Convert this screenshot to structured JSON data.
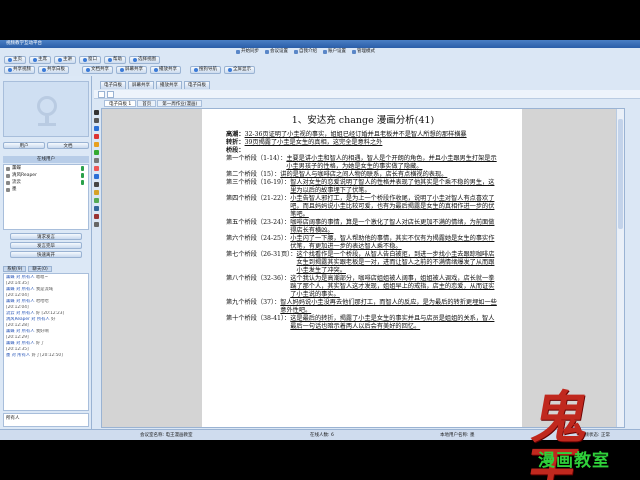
{
  "app": {
    "title": "视频教学互动平台",
    "menu": [
      "开始同步",
      "会议设置",
      "自我介绍",
      "账户设置",
      "管理模式"
    ]
  },
  "left_toolbar": {
    "row1": [
      "主页",
      "主席",
      "主讲",
      "窗口",
      "帮助",
      "选择视图"
    ],
    "row2": [
      "共享视频",
      "共享白板"
    ]
  },
  "right_toolbar": {
    "row1": [
      "文档共享",
      "屏幕共享",
      "播放共享",
      "搜狗导航",
      "全屏显示"
    ],
    "doc_tabs": [
      "电子白板",
      "屏幕共享",
      "播放共享",
      "电子白板"
    ],
    "sub_tabs": [
      "电子白板 1",
      "首页",
      "第一周作业(漫画)"
    ]
  },
  "left_panel": {
    "tabs": [
      "用户",
      "文档"
    ],
    "userlist_header": "在线用户",
    "users": [
      "薰蝶",
      "清风Reaper",
      "流云",
      "墨"
    ],
    "request_button": "请求发言",
    "release_button": "发言完毕",
    "fast_button": "快速离开",
    "chat_tabs": [
      "系统(9)",
      "聊天(0)"
    ],
    "chat_lines": [
      {
        "name": "薰蝶 对 所有人",
        "text": "嗯嗯~"
      },
      {
        "name": "",
        "text": "[20:14:35]"
      },
      {
        "name": "薰蝶 对 所有人",
        "text": "我是流域"
      },
      {
        "name": "",
        "text": "[20:12:04]"
      },
      {
        "name": "薰蝶 对 所有人",
        "text": "哈哈哈"
      },
      {
        "name": "",
        "text": "[20:12:04]"
      },
      {
        "name": "流云 对 所有人",
        "text": "好 [20:12:23]"
      },
      {
        "name": "清风Reaper 对 所有人",
        "text": "好"
      },
      {
        "name": "",
        "text": "[20:12:28]"
      },
      {
        "name": "薰蝶 对 所有人",
        "text": "我好啊"
      },
      {
        "name": "",
        "text": "[20:12:29]"
      },
      {
        "name": "薰蝶 对 所有人",
        "text": "好了"
      },
      {
        "name": "",
        "text": "[20:12:35]"
      },
      {
        "name": "墨 对 所有人",
        "text": "好了[20:12:50]"
      }
    ],
    "input_placeholder": "所有人",
    "send_button": "发送"
  },
  "document": {
    "title": "1、安达充 change 漫画分析(41)",
    "intro": [
      {
        "label": "高潮：",
        "text": "32-36页证明了小圭视的事实，姐姐已经订婚并且老板并不是智人所想的那样横暴"
      },
      {
        "label": "转折：",
        "text": "39页揭露了小圭是女生的真相，这完全是意料之外"
      },
      {
        "label": "桥段：",
        "text": ""
      }
    ],
    "segments": [
      {
        "label": "第一个桥段（1-14）：",
        "text": "主要是讲小圭和智人的相遇，智人是个开朗的角色，并且小圭跟男生打架是示小圭男孩子的性格，为她是女生的事实做了隐藏。"
      },
      {
        "label": "第二个桥段（15）：",
        "text": "讲的是智人与咖啡店之间人物的联系，店长有点横视的表现。"
      },
      {
        "label": "第三个桥段（16-19）：",
        "text": "智人对女生的恋爱说明了智人的性格并表现了他其实是个乘不稳的男生，这里为以后的故事埋下了伏笔。"
      },
      {
        "label": "第四个桥段（21-22）：",
        "text": "小圭告智人邪打工，是为上一个桥段作收尾，说明了小圭对智人有点喜欢了吧，而且妈妈说小圭比较可爱，也有为最后揭露是女生的真相作进一步的伏笔吧。"
      },
      {
        "label": "第五个桥段（23-24）：",
        "text": "咖啡店阔事的事情，算是一个激化了智人对店长更加不满的情绪，为前面做得店长有横凶。"
      },
      {
        "label": "第六个桥段（24-25）：",
        "text": "小圭闪了一下腰，智人帮助他的事情，其实不仅有为揭露她是女生的事实作伏笔，有更加进一步的表达智人乘不稳。"
      },
      {
        "label": "第七个桥段（26-31页）：",
        "text": "这个找看作是一个桥段，从智人告白被拒，到进一步找小圭去跟踪咖啡店女生到揭露其实跟老板是一对，进而让智人之前的不满情绪爆发了从而跟小圭发生了冲突。"
      },
      {
        "label": "第八个桥段（32-36）：",
        "text": "这个我认为是高潮部分，咖啡店姐姐被人阔事，姐姐被人调戏，店长就一拳踹了那个人，其实智人这才发现，姐姐早上的戒指，店主的恋爱，从而证实了小圭说的事实。"
      },
      {
        "label": "第九个桥段（37）：",
        "text": "智人妈妈说小圭没再去他们那打工，而智人的反应，是为最后的转折更埋如一些意外性吧。"
      },
      {
        "label": "第十个桥段（38-41）：",
        "text": "这是最后的转折，揭露了小圭是女生的事实并且与店员是姐姐的关系，智人最后一句话也暗示着两人以后会有美好的回忆。"
      }
    ]
  },
  "status_bar": {
    "meeting": "会议室名称: 电王漫画教室",
    "online": "在线人数: 6",
    "user": "本地用户名称: 墨",
    "status": "音频状态: 正常"
  },
  "watermark": {
    "calligraphy": "鬼王",
    "caption": "漫画教室"
  }
}
